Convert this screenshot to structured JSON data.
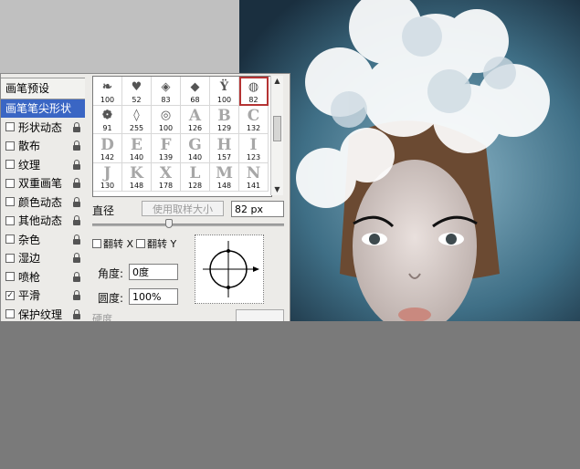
{
  "nav": {
    "header": "画笔预设",
    "selected": "画笔笔尖形状",
    "items": [
      {
        "label": "形状动态",
        "checked": false,
        "locked": true
      },
      {
        "label": "散布",
        "checked": false,
        "locked": true
      },
      {
        "label": "纹理",
        "checked": false,
        "locked": true
      },
      {
        "label": "双重画笔",
        "checked": false,
        "locked": true
      },
      {
        "label": "颜色动态",
        "checked": false,
        "locked": true
      },
      {
        "label": "其他动态",
        "checked": false,
        "locked": true
      },
      {
        "label": "杂色",
        "checked": false,
        "locked": true
      },
      {
        "label": "湿边",
        "checked": false,
        "locked": true
      },
      {
        "label": "喷枪",
        "checked": false,
        "locked": true
      },
      {
        "label": "平滑",
        "checked": true,
        "locked": true
      },
      {
        "label": "保护纹理",
        "checked": false,
        "locked": true
      }
    ]
  },
  "brushes": [
    {
      "glyph": "❧",
      "size": "100",
      "dark": true
    },
    {
      "glyph": "♥",
      "size": "52",
      "dark": true
    },
    {
      "glyph": "◈",
      "size": "83",
      "dark": true
    },
    {
      "glyph": "◆",
      "size": "68",
      "dark": true
    },
    {
      "glyph": "Ÿ",
      "size": "100",
      "dark": true
    },
    {
      "glyph": "◍",
      "size": "82",
      "dark": true,
      "selected": true
    },
    {
      "glyph": "❁",
      "size": "91",
      "dark": true
    },
    {
      "glyph": "◊",
      "size": "255",
      "dark": true
    },
    {
      "glyph": "◎",
      "size": "100",
      "dark": true
    },
    {
      "glyph": "A",
      "size": "126",
      "dark": false
    },
    {
      "glyph": "B",
      "size": "129",
      "dark": false
    },
    {
      "glyph": "C",
      "size": "132",
      "dark": false
    },
    {
      "glyph": "D",
      "size": "142",
      "dark": false
    },
    {
      "glyph": "E",
      "size": "140",
      "dark": false
    },
    {
      "glyph": "F",
      "size": "139",
      "dark": false
    },
    {
      "glyph": "G",
      "size": "140",
      "dark": false
    },
    {
      "glyph": "H",
      "size": "157",
      "dark": false
    },
    {
      "glyph": "I",
      "size": "123",
      "dark": false
    },
    {
      "glyph": "J",
      "size": "130",
      "dark": false
    },
    {
      "glyph": "K",
      "size": "148",
      "dark": false
    },
    {
      "glyph": "X",
      "size": "178",
      "dark": false
    },
    {
      "glyph": "L",
      "size": "128",
      "dark": false
    },
    {
      "glyph": "M",
      "size": "148",
      "dark": false
    },
    {
      "glyph": "N",
      "size": "141",
      "dark": false
    }
  ],
  "diameter": {
    "label": "直径",
    "sample_button": "使用取样大小",
    "value": "82 px",
    "slider": 0.4
  },
  "flip": {
    "x_label": "翻转 X",
    "y_label": "翻转 Y",
    "x": false,
    "y": false
  },
  "angle": {
    "label": "角度:",
    "value": "0度"
  },
  "roundness": {
    "label": "圆度:",
    "value": "100%"
  },
  "hardness": {
    "label": "硬度"
  },
  "icons": {
    "lock": "lock-icon",
    "scroll_up": "scroll-up-arrow-icon",
    "scroll_down": "scroll-down-arrow-icon",
    "resize": "resize-grip-icon",
    "angle_preview": "brush-angle-crosshair-icon"
  },
  "colors": {
    "selection": "#3a66c4",
    "selected_brush_outline": "#b53434",
    "background_gray": "#7a7a7a"
  }
}
